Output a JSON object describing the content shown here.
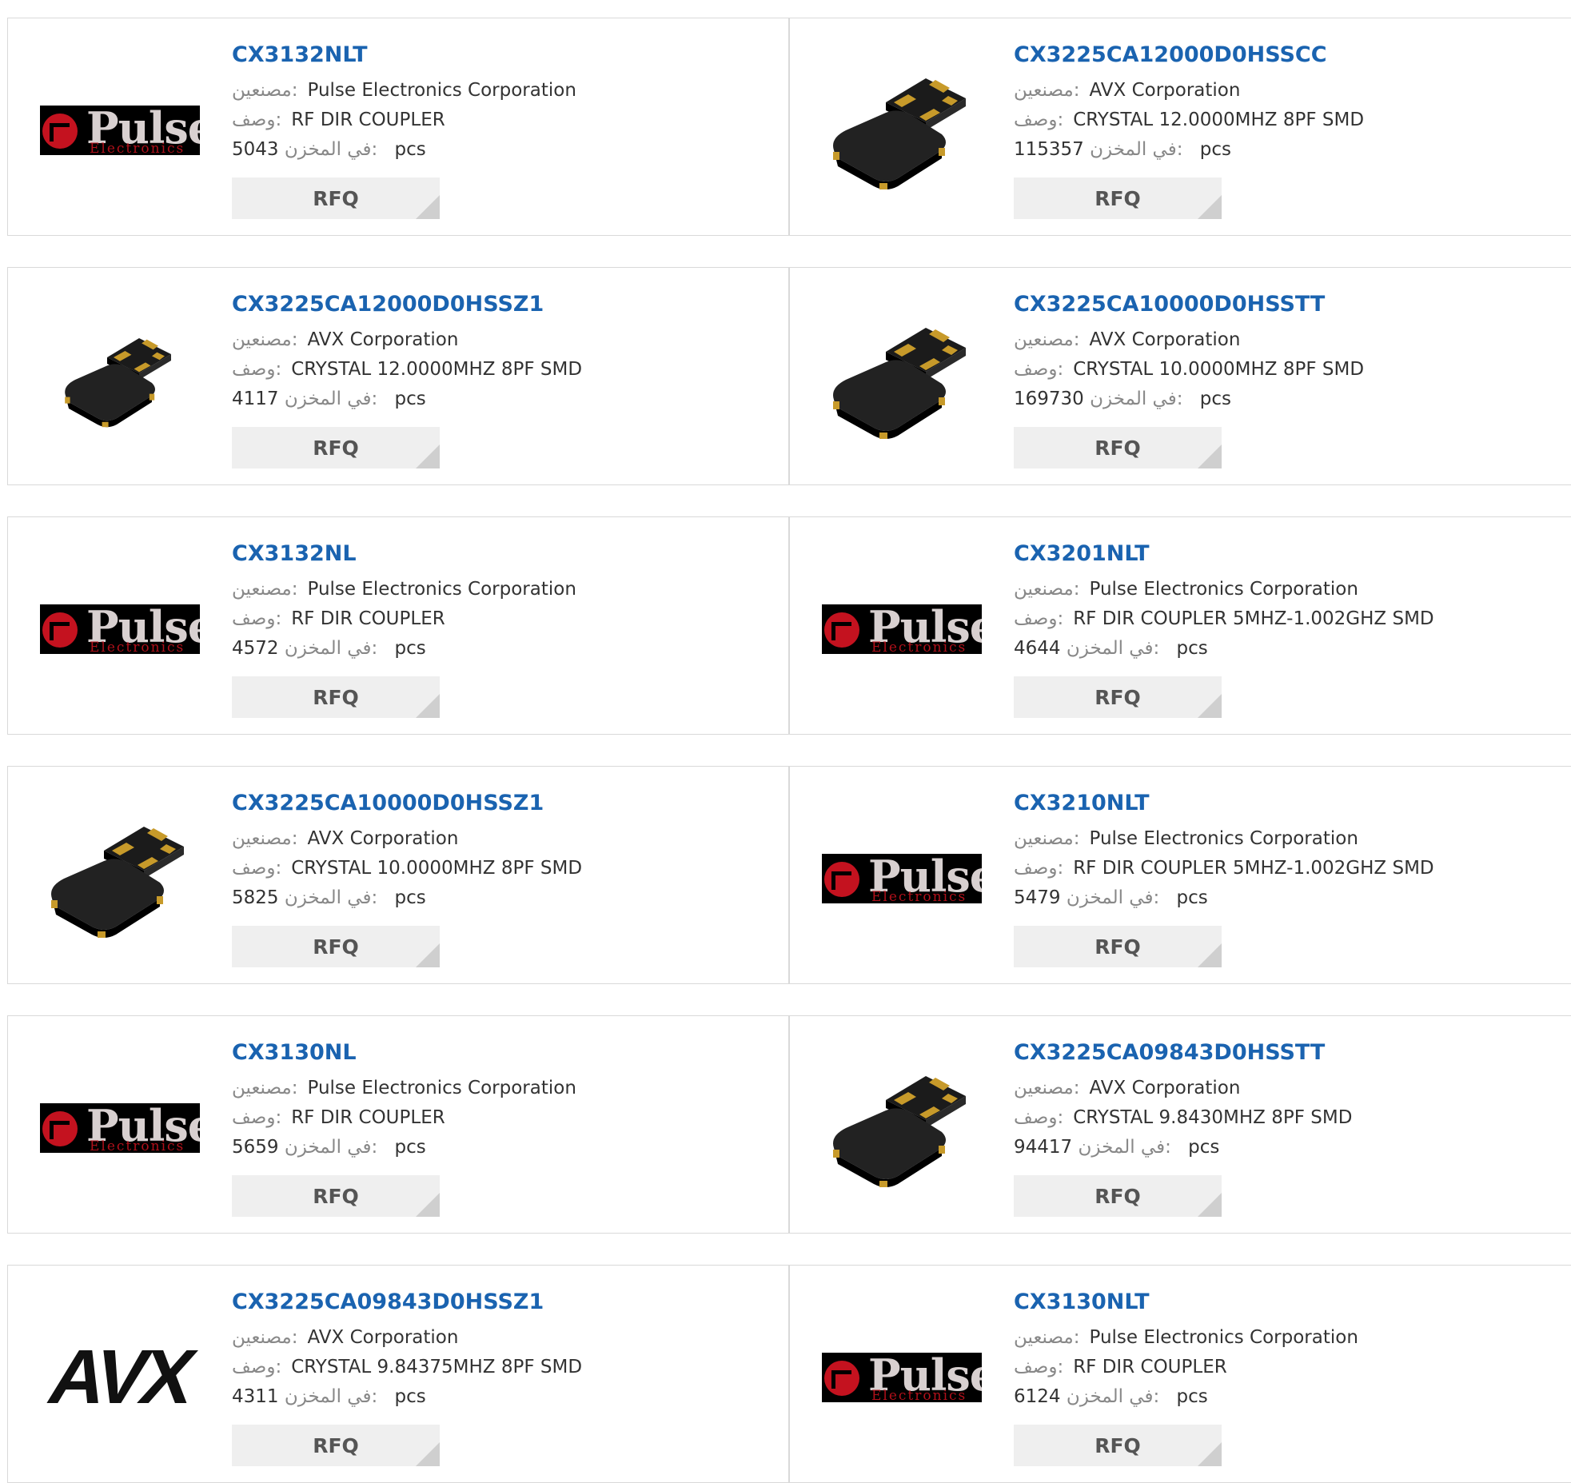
{
  "labels": {
    "manufacturer": "مصنعين:",
    "description": "وصف:",
    "stock": "في المخزن:",
    "unit": "pcs",
    "rfq": "RFQ"
  },
  "products": [
    {
      "part": "CX3132NLT",
      "manufacturer": "Pulse Electronics Corporation",
      "description": "RF DIR COUPLER",
      "stock": "5043",
      "image": "pulse-logo"
    },
    {
      "part": "CX3225CA12000D0HSSCC",
      "manufacturer": "AVX Corporation",
      "description": "CRYSTAL 12.0000MHZ 8PF SMD",
      "stock": "115357",
      "image": "crystal-large"
    },
    {
      "part": "CX3225CA12000D0HSSZ1",
      "manufacturer": "AVX Corporation",
      "description": "CRYSTAL 12.0000MHZ 8PF SMD",
      "stock": "4117",
      "image": "crystal-small"
    },
    {
      "part": "CX3225CA10000D0HSSTT",
      "manufacturer": "AVX Corporation",
      "description": "CRYSTAL 10.0000MHZ 8PF SMD",
      "stock": "169730",
      "image": "crystal-large"
    },
    {
      "part": "CX3132NL",
      "manufacturer": "Pulse Electronics Corporation",
      "description": "RF DIR COUPLER",
      "stock": "4572",
      "image": "pulse-logo"
    },
    {
      "part": "CX3201NLT",
      "manufacturer": "Pulse Electronics Corporation",
      "description": "RF DIR COUPLER 5MHZ-1.002GHZ SMD",
      "stock": "4644",
      "image": "pulse-logo"
    },
    {
      "part": "CX3225CA10000D0HSSZ1",
      "manufacturer": "AVX Corporation",
      "description": "CRYSTAL 10.0000MHZ 8PF SMD",
      "stock": "5825",
      "image": "crystal-large"
    },
    {
      "part": "CX3210NLT",
      "manufacturer": "Pulse Electronics Corporation",
      "description": "RF DIR COUPLER 5MHZ-1.002GHZ SMD",
      "stock": "5479",
      "image": "pulse-logo"
    },
    {
      "part": "CX3130NL",
      "manufacturer": "Pulse Electronics Corporation",
      "description": "RF DIR COUPLER",
      "stock": "5659",
      "image": "pulse-logo"
    },
    {
      "part": "CX3225CA09843D0HSSTT",
      "manufacturer": "AVX Corporation",
      "description": "CRYSTAL 9.8430MHZ 8PF SMD",
      "stock": "94417",
      "image": "crystal-large"
    },
    {
      "part": "CX3225CA09843D0HSSZ1",
      "manufacturer": "AVX Corporation",
      "description": "CRYSTAL 9.84375MHZ 8PF SMD",
      "stock": "4311",
      "image": "avx-logo"
    },
    {
      "part": "CX3130NLT",
      "manufacturer": "Pulse Electronics Corporation",
      "description": "RF DIR COUPLER",
      "stock": "6124",
      "image": "pulse-logo"
    }
  ],
  "brand_text": {
    "pulse_word": "Pulse",
    "pulse_sub": "Electronics",
    "avx_word": "AVX"
  }
}
